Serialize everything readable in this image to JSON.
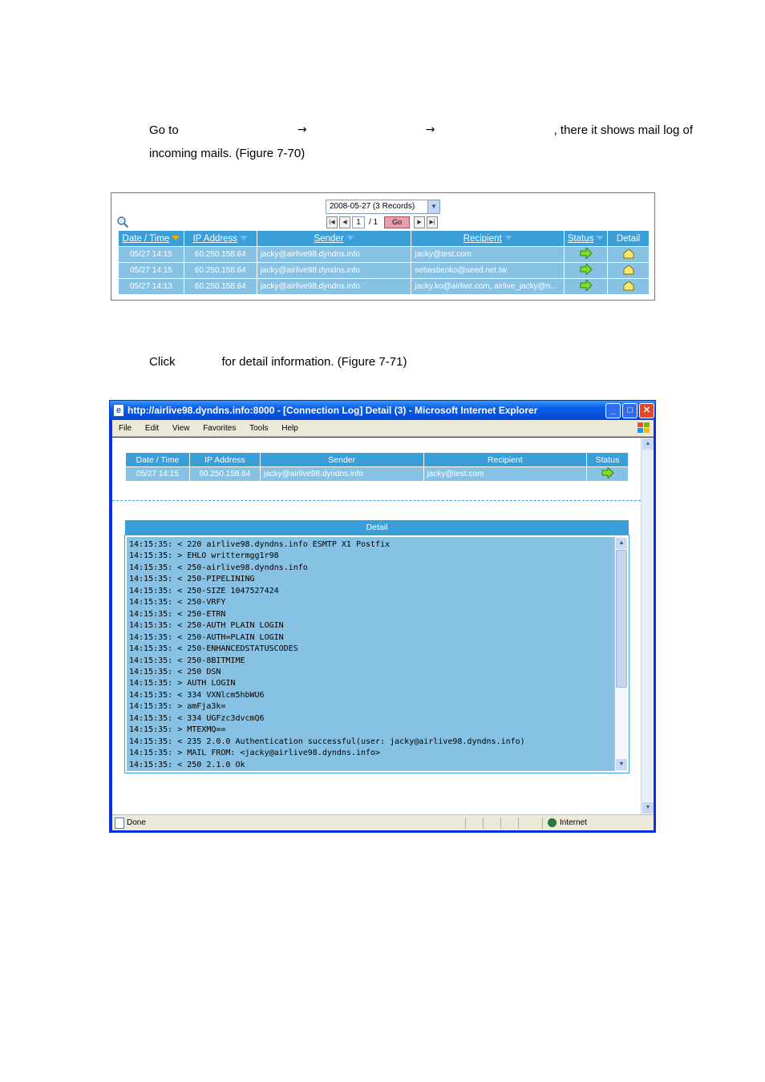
{
  "intro": {
    "go_to": "Go to",
    "arrow": "→",
    "tail": ", there it shows mail log of",
    "line2": "incoming mails. (Figure 7-70)"
  },
  "mail_log": {
    "date_select_value": "2008-05-27 (3 Records)",
    "page_current": "1",
    "page_total": "/ 1",
    "go_label": "Go",
    "columns": [
      "Date / Time",
      "IP Address",
      "Sender",
      "Recipient",
      "Status",
      "Detail"
    ],
    "rows": [
      {
        "datetime": "05/27 14:15",
        "ip": "60.250.158.64",
        "sender": "jacky@airlive98.dyndns.info",
        "recipient": "jacky@test.com"
      },
      {
        "datetime": "05/27 14:15",
        "ip": "60.250.158.64",
        "sender": "jacky@airlive98.dyndns.info",
        "recipient": "sebastienko@seed.net.tw"
      },
      {
        "datetime": "05/27 14:13",
        "ip": "60.250.158.64",
        "sender": "jacky@airlive98.dyndns.info",
        "recipient": "jacky.ko@airlive.com, airlive_jacky@n..."
      }
    ]
  },
  "click_text": {
    "click": "Click",
    "rest": "for detail information. (Figure 7-71)"
  },
  "browser": {
    "title": "http://airlive98.dyndns.info:8000 - [Connection Log] Detail (3) - Microsoft Internet Explorer",
    "menu": [
      "File",
      "Edit",
      "View",
      "Favorites",
      "Tools",
      "Help"
    ],
    "status_left": "Done",
    "status_zone": "Internet"
  },
  "detail": {
    "columns": [
      "Date / Time",
      "IP Address",
      "Sender",
      "Recipient",
      "Status"
    ],
    "row": {
      "datetime": "05/27 14:15",
      "ip": "60.250.158.64",
      "sender": "jacky@airlive98.dyndns.info",
      "recipient": "jacky@test.com"
    },
    "header": "Detail",
    "log_lines": [
      "14:15:35: < 220 airlive98.dyndns.info ESMTP X1 Postfix",
      "14:15:35: > EHLO writtermgg1r98",
      "14:15:35: < 250-airlive98.dyndns.info",
      "14:15:35: < 250-PIPELINING",
      "14:15:35: < 250-SIZE 1047527424",
      "14:15:35: < 250-VRFY",
      "14:15:35: < 250-ETRN",
      "14:15:35: < 250-AUTH PLAIN LOGIN",
      "14:15:35: < 250-AUTH=PLAIN LOGIN",
      "14:15:35: < 250-ENHANCEDSTATUSCODES",
      "14:15:35: < 250-8BITMIME",
      "14:15:35: < 250 DSN",
      "14:15:35: > AUTH LOGIN",
      "14:15:35: < 334 VXNlcm5hbWU6",
      "14:15:35: > amFja3k=",
      "14:15:35: < 334 UGFzc3dvcmQ6",
      "14:15:35: > MTEXMQ==",
      "14:15:35: < 235 2.0.0 Authentication successful(user: jacky@airlive98.dyndns.info)",
      "14:15:35: > MAIL FROM: <jacky@airlive98.dyndns.info>",
      "14:15:35: < 250 2.1.0 Ok"
    ]
  }
}
